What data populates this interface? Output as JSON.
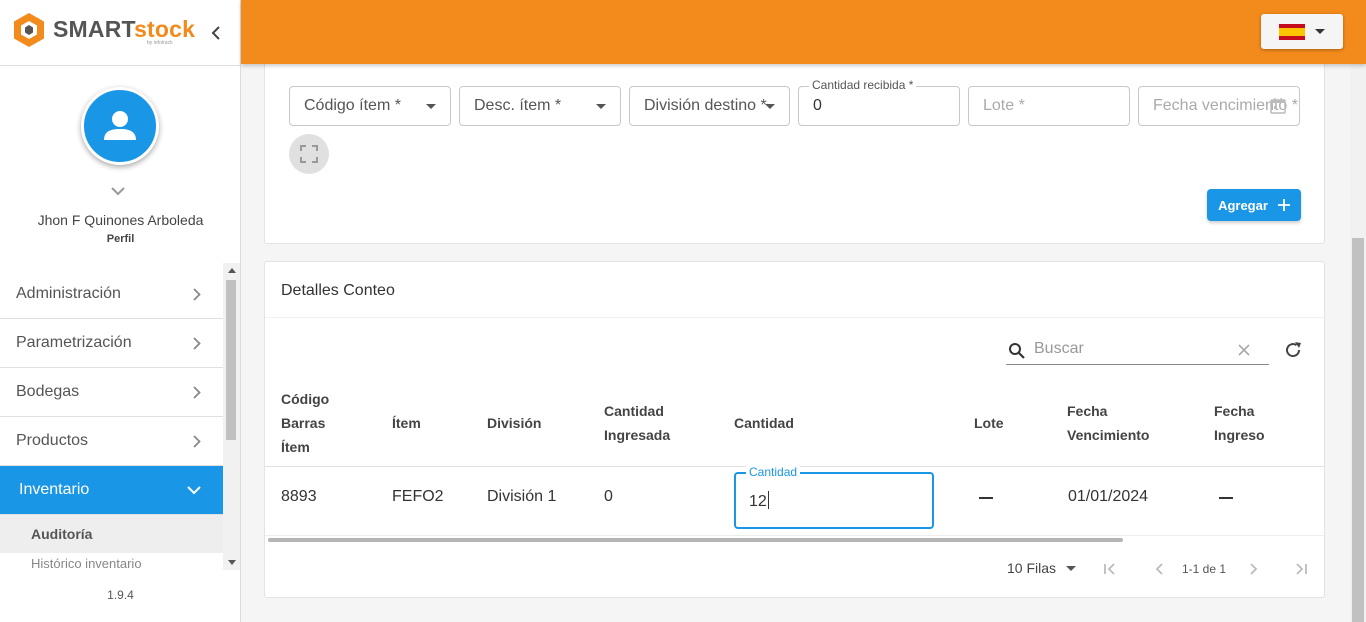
{
  "brand": {
    "name_a": "SMART",
    "name_b": "stock",
    "sub": "by infotrack"
  },
  "user": {
    "name": "Jhon F Quinones Arboleda",
    "profile_label": "Perfil"
  },
  "menu": {
    "items": [
      {
        "label": "Administración"
      },
      {
        "label": "Parametrización"
      },
      {
        "label": "Bodegas"
      },
      {
        "label": "Productos"
      },
      {
        "label": "Inventario"
      }
    ],
    "active_index": 4,
    "sub_items": [
      {
        "label": "Auditoría"
      },
      {
        "label": "Histórico inventario"
      }
    ]
  },
  "version": "1.9.4",
  "header": {
    "language": "es"
  },
  "form": {
    "codigo_item": "Código ítem *",
    "desc_item": "Desc. ítem *",
    "division_destino": "División destino *",
    "cantidad_label": "Cantidad recibida *",
    "cantidad_value": "0",
    "lote": "Lote *",
    "fecha_vencimiento": "Fecha vencimiento *",
    "add_label": "Agregar"
  },
  "details": {
    "title": "Detalles Conteo",
    "search_placeholder": "Buscar",
    "columns": {
      "codigo_1": "Código",
      "codigo_2": "Barras",
      "codigo_3": "Ítem",
      "item": "Ítem",
      "division": "División",
      "cant_ing_1": "Cantidad",
      "cant_ing_2": "Ingresada",
      "cantidad": "Cantidad",
      "lote": "Lote",
      "fv_1": "Fecha",
      "fv_2": "Vencimiento",
      "fi_1": "Fecha",
      "fi_2": "Ingreso"
    },
    "row": {
      "codigo": "8893",
      "item": "FEFO2",
      "division": "División 1",
      "cantidad_ingresada": "0",
      "cantidad_label": "Cantidad",
      "cantidad_value": "12",
      "fecha_vencimiento": "01/01/2024"
    },
    "pager": {
      "rows_label": "10 Filas",
      "range": "1-1 de 1"
    }
  }
}
